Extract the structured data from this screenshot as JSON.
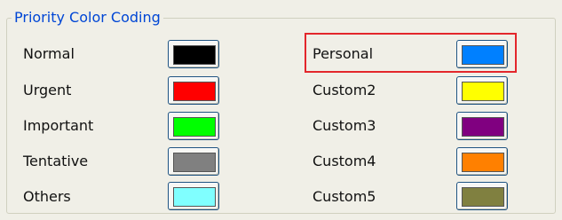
{
  "group": {
    "title": "Priority Color Coding"
  },
  "left_rows": [
    {
      "label": "Normal",
      "color": "#000000"
    },
    {
      "label": "Urgent",
      "color": "#ff0000"
    },
    {
      "label": "Important",
      "color": "#00ff00"
    },
    {
      "label": "Tentative",
      "color": "#808080"
    },
    {
      "label": "Others",
      "color": "#80ffff"
    }
  ],
  "right_rows": [
    {
      "label": "Personal",
      "color": "#0080ff"
    },
    {
      "label": "Custom2",
      "color": "#ffff00"
    },
    {
      "label": "Custom3",
      "color": "#800080"
    },
    {
      "label": "Custom4",
      "color": "#ff8000"
    },
    {
      "label": "Custom5",
      "color": "#808040"
    }
  ],
  "highlight": {
    "color": "#e3262b"
  }
}
